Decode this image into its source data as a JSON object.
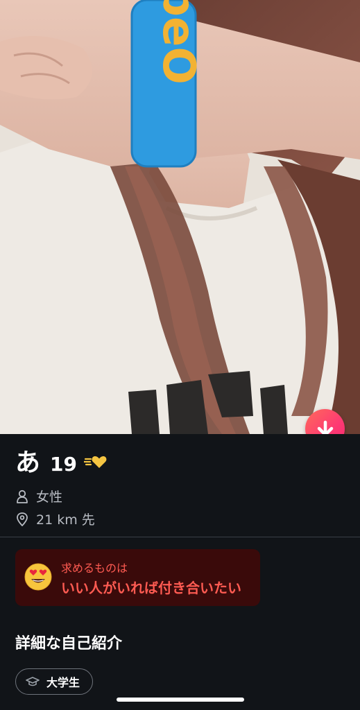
{
  "profile": {
    "name": "あ",
    "age": "19",
    "gender": "女性",
    "distance": "21 km 先"
  },
  "looking_for": {
    "title": "求めるものは",
    "value": "いい人がいれば付き合いたい",
    "emoji_icon": "heart-eyes-icon"
  },
  "details": {
    "title": "詳細な自己紹介",
    "chips": [
      {
        "label": "大学生",
        "icon": "graduation-cap-icon"
      }
    ]
  },
  "photo": {
    "wristband_text": "beO"
  },
  "colors": {
    "background": "#111418",
    "accent_gradient_start": "#ff6a5a",
    "accent_gradient_end": "#f9286f",
    "looking_card_bg": "#3a0a0a",
    "looking_text": "#ff5b52",
    "super_like_gold": "#f5c542"
  }
}
